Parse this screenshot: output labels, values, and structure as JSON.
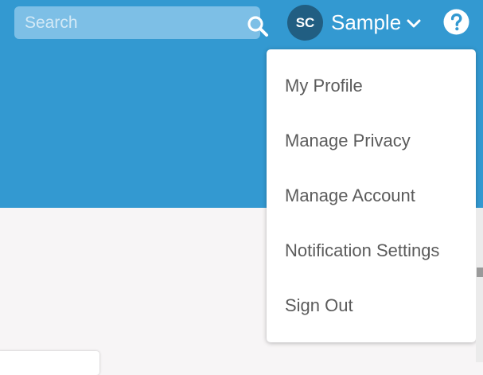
{
  "header": {
    "band_color": "#3399d1"
  },
  "search": {
    "placeholder": "Search",
    "value": "",
    "icon": "search-icon"
  },
  "account": {
    "avatar_initials": "SC",
    "name": "Sample",
    "chevron_icon": "chevron-down-icon",
    "avatar_color": "#215e82"
  },
  "help": {
    "icon": "help-icon"
  },
  "account_menu": {
    "items": [
      {
        "label": "My Profile"
      },
      {
        "label": "Manage Privacy"
      },
      {
        "label": "Manage Account"
      },
      {
        "label": "Notification Settings"
      },
      {
        "label": "Sign Out"
      }
    ]
  }
}
